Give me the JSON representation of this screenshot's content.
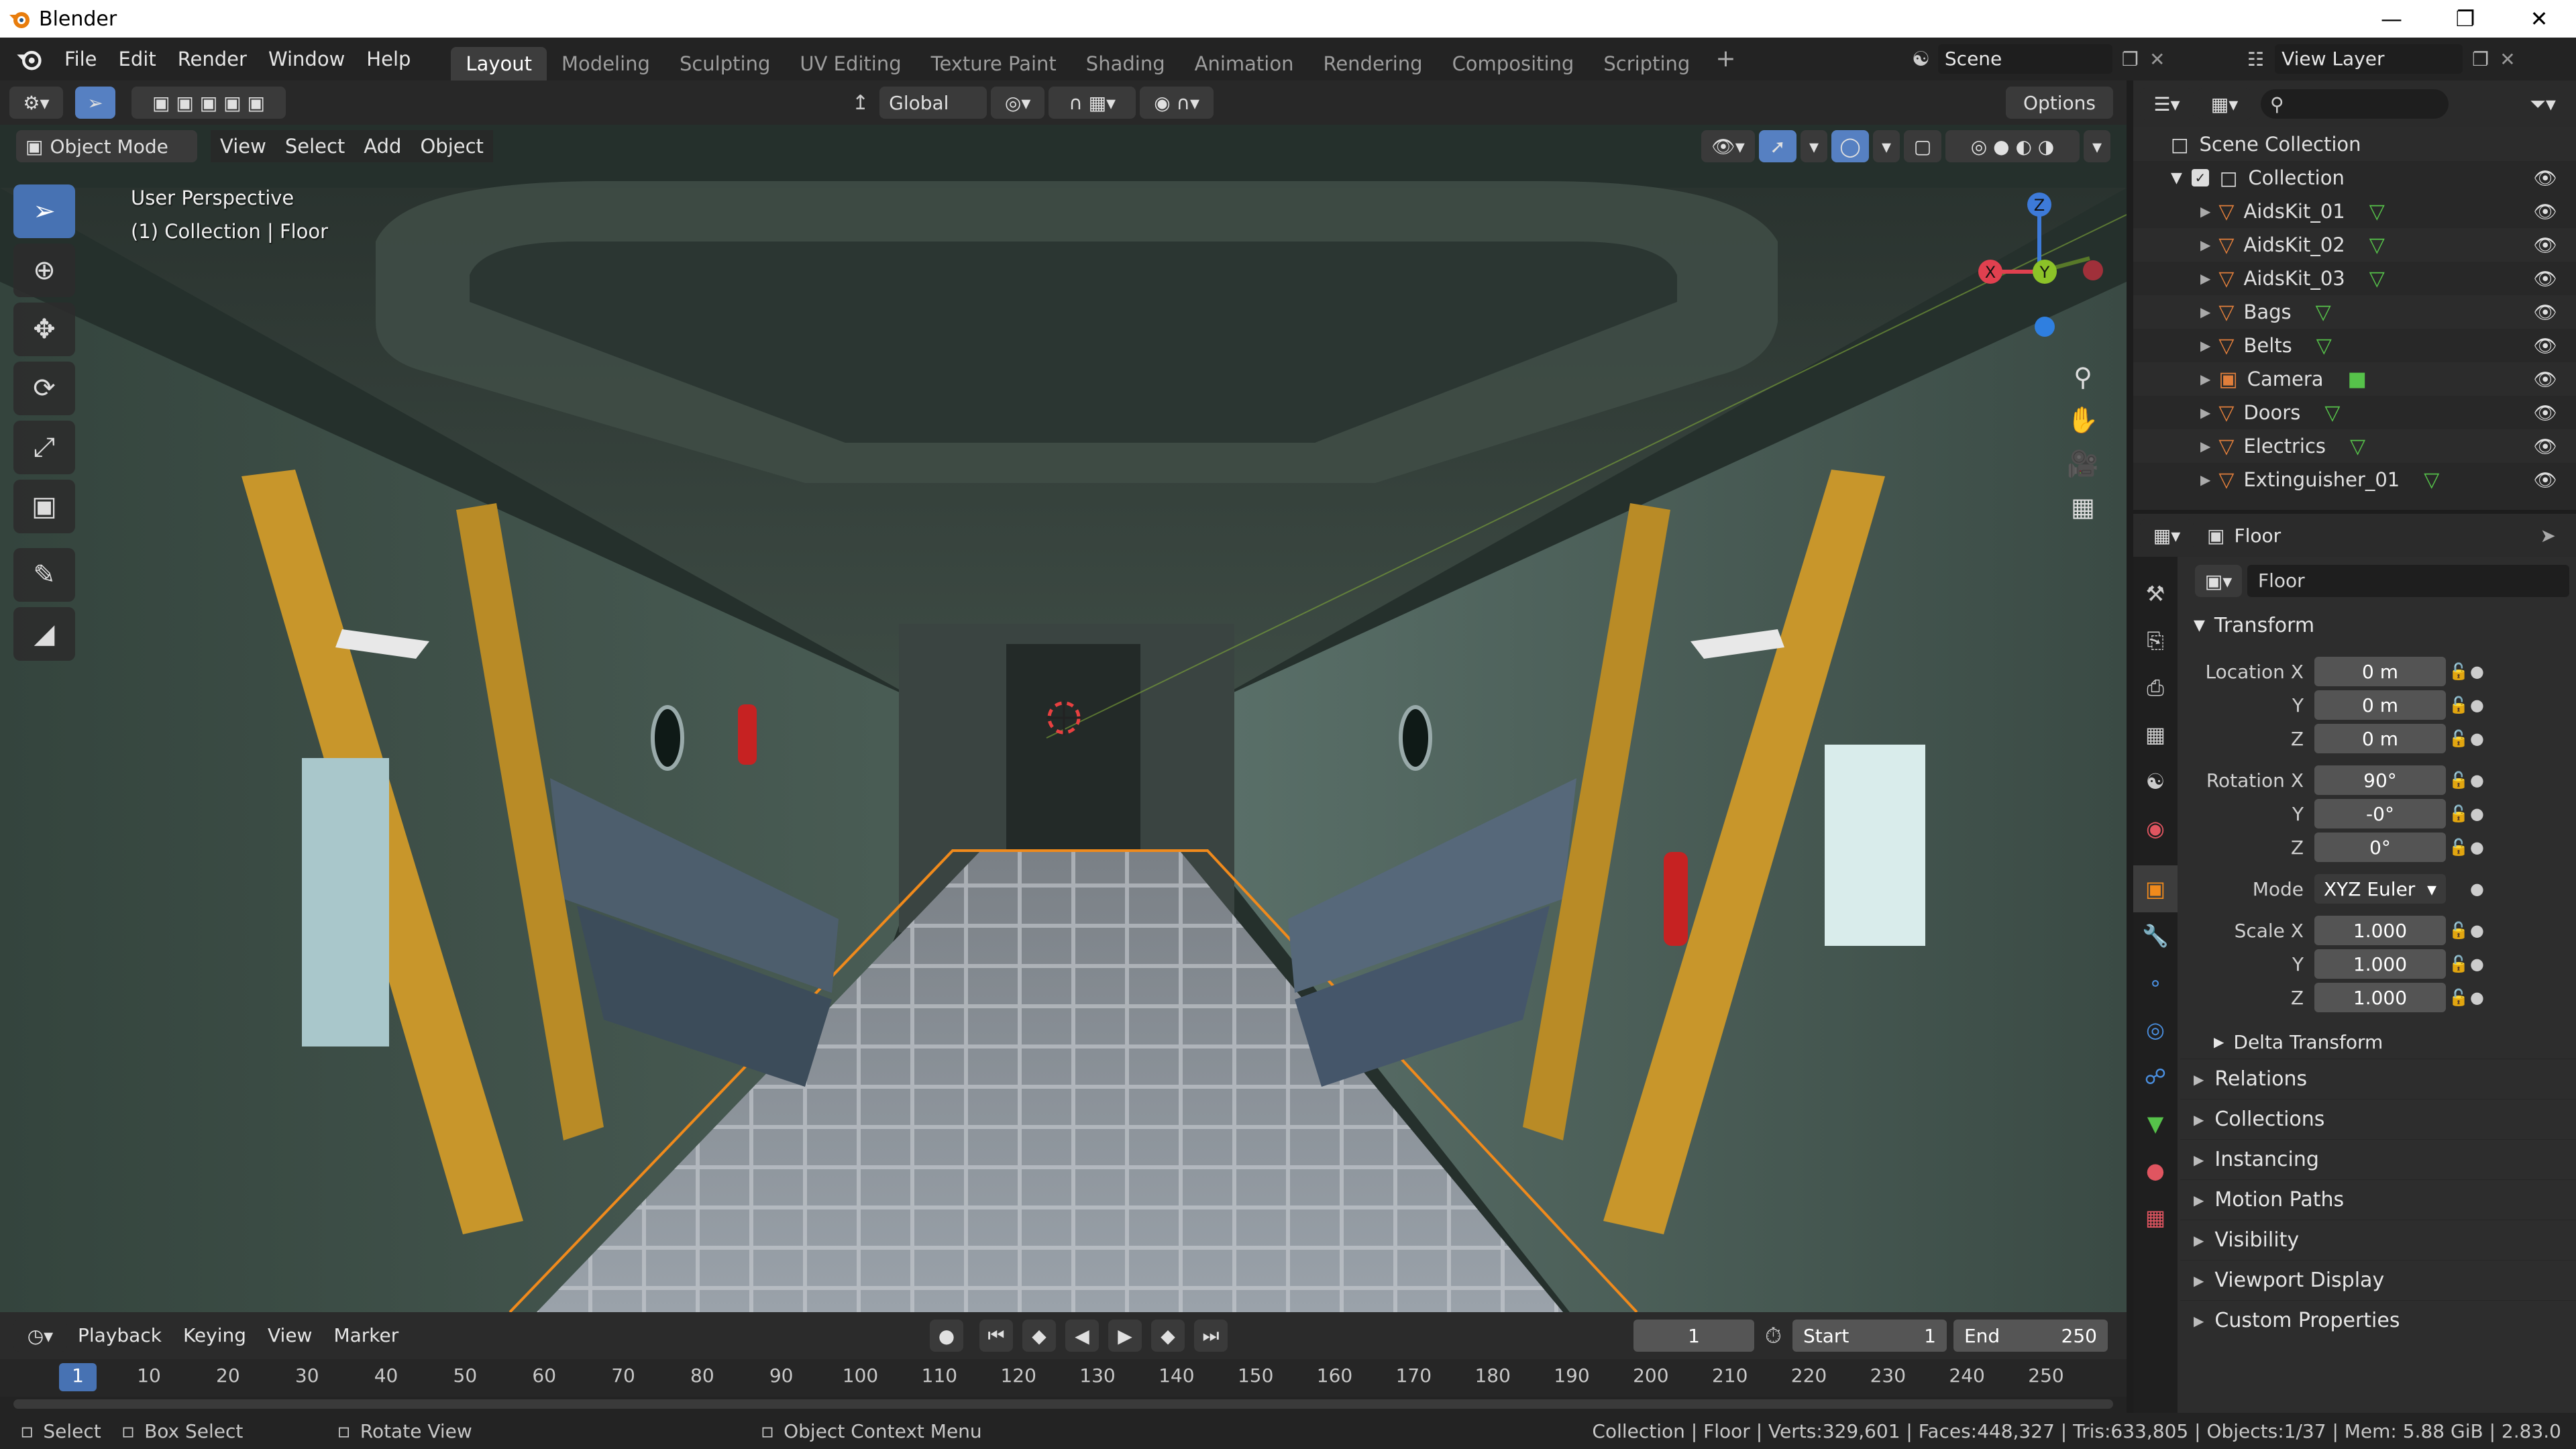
{
  "window": {
    "app_name": "Blender"
  },
  "menus": [
    "File",
    "Edit",
    "Render",
    "Window",
    "Help"
  ],
  "workspaces": [
    {
      "label": "Layout",
      "active": true
    },
    {
      "label": "Modeling",
      "active": false
    },
    {
      "label": "Sculpting",
      "active": false
    },
    {
      "label": "UV Editing",
      "active": false
    },
    {
      "label": "Texture Paint",
      "active": false
    },
    {
      "label": "Shading",
      "active": false
    },
    {
      "label": "Animation",
      "active": false
    },
    {
      "label": "Rendering",
      "active": false
    },
    {
      "label": "Compositing",
      "active": false
    },
    {
      "label": "Scripting",
      "active": false
    }
  ],
  "scene": {
    "name": "Scene"
  },
  "view_layer": {
    "name": "View Layer"
  },
  "viewport": {
    "transform_orientation": "Global",
    "options_label": "Options",
    "mode": "Object Mode",
    "menus": [
      "View",
      "Select",
      "Add",
      "Object"
    ],
    "info_line1": "User Perspective",
    "info_line2": "(1) Collection | Floor"
  },
  "outliner": {
    "root": "Scene Collection",
    "collection": "Collection",
    "items": [
      {
        "name": "AidsKit_01",
        "type": "mesh"
      },
      {
        "name": "AidsKit_02",
        "type": "mesh"
      },
      {
        "name": "AidsKit_03",
        "type": "mesh"
      },
      {
        "name": "Bags",
        "type": "mesh"
      },
      {
        "name": "Belts",
        "type": "mesh"
      },
      {
        "name": "Camera",
        "type": "camera"
      },
      {
        "name": "Doors",
        "type": "mesh"
      },
      {
        "name": "Electrics",
        "type": "mesh"
      },
      {
        "name": "Extinguisher_01",
        "type": "mesh"
      }
    ]
  },
  "properties": {
    "object_name_header": "Floor",
    "object_name_field": "Floor",
    "transform_label": "Transform",
    "location": {
      "label_x": "Location X",
      "x": "0 m",
      "y": "0 m",
      "z": "0 m"
    },
    "rotation": {
      "label_x": "Rotation X",
      "x": "90°",
      "y": "-0°",
      "z": "0°"
    },
    "mode_label": "Mode",
    "mode_value": "XYZ Euler",
    "scale": {
      "label_x": "Scale X",
      "x": "1.000",
      "y": "1.000",
      "z": "1.000"
    },
    "axis_y": "Y",
    "axis_z": "Z",
    "delta_transform": "Delta Transform",
    "panels": [
      "Relations",
      "Collections",
      "Instancing",
      "Motion Paths",
      "Visibility",
      "Viewport Display",
      "Custom Properties"
    ]
  },
  "timeline": {
    "menus": [
      "Playback",
      "Keying",
      "View",
      "Marker"
    ],
    "current_frame": "1",
    "start_label": "Start",
    "start": "1",
    "end_label": "End",
    "end": "250",
    "ticks": [
      "1",
      "10",
      "20",
      "30",
      "40",
      "50",
      "60",
      "70",
      "80",
      "90",
      "100",
      "110",
      "120",
      "130",
      "140",
      "150",
      "160",
      "170",
      "180",
      "190",
      "200",
      "210",
      "220",
      "230",
      "240",
      "250"
    ]
  },
  "statusbar": {
    "select": "Select",
    "box_select": "Box Select",
    "rotate_view": "Rotate View",
    "context_menu": "Object Context Menu",
    "stats": "Collection | Floor | Verts:329,601 | Faces:448,327 | Tris:633,805 | Objects:1/37 | Mem: 5.88 GiB | 2.83.0"
  },
  "colors": {
    "accent": "#4772b3",
    "selection_outline": "#f08a1c",
    "mesh_icon": "#e07e3b",
    "vertex_icon": "#56c24a",
    "axis_x": "#e0404f",
    "axis_y": "#8cc228",
    "axis_z": "#3d7ad9"
  }
}
